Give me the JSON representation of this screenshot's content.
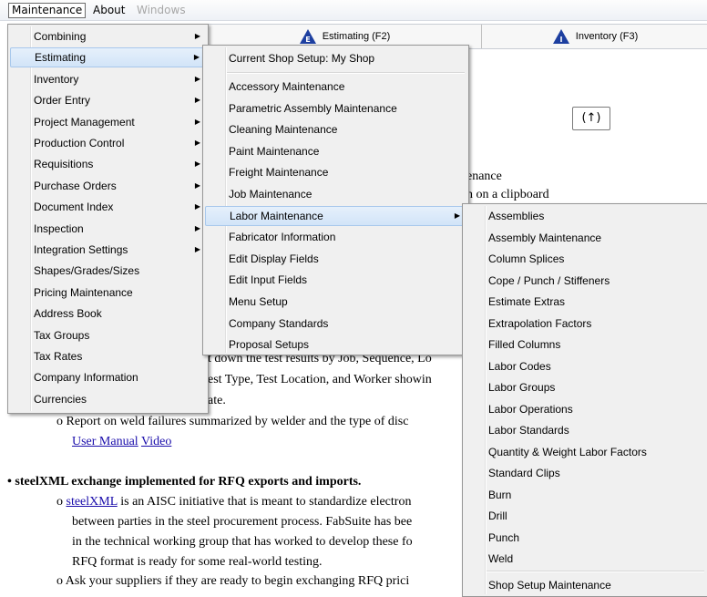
{
  "menubar": {
    "maintenance": "Maintenance",
    "about": "About",
    "windows": "Windows"
  },
  "tabs": {
    "estimating": "Estimating (F2)",
    "inventory": "Inventory (F3)"
  },
  "help_button": "(↑)",
  "document": {
    "fragment_1": "enance",
    "fragment_2": "n on a clipboard",
    "line_a": "t down the test results by Job, Sequence, Lo",
    "line_b": "est Type, Test Location, and Worker showin",
    "line_c": "ate.",
    "bullet_weld": "Report on weld failures summarized by welder and the type of disc",
    "link_manual": "User Manual",
    "link_video": "Video",
    "heading_steelxml": "steelXML exchange implemented for RFQ exports and imports.",
    "link_steelxml": "steelXML",
    "steelxml_line_1": " is an AISC initiative that is meant to standardize electron",
    "steelxml_line_2": "between parties in the steel procurement process. FabSuite has bee",
    "steelxml_line_3": "in the technical working group that has worked to develop these fo",
    "steelxml_line_4": "RFQ format is ready for some real-world testing.",
    "steelxml_line_5": "Ask your suppliers if they are ready to begin exchanging RFQ prici"
  },
  "main_menu": [
    {
      "label": "Combining",
      "submenu": true
    },
    {
      "label": "Estimating",
      "submenu": true,
      "highlighted": true
    },
    {
      "label": "Inventory",
      "submenu": true
    },
    {
      "label": "Order Entry",
      "submenu": true
    },
    {
      "label": "Project Management",
      "submenu": true
    },
    {
      "label": "Production Control",
      "submenu": true
    },
    {
      "label": "Requisitions",
      "submenu": true
    },
    {
      "label": "Purchase Orders",
      "submenu": true
    },
    {
      "label": "Document Index",
      "submenu": true
    },
    {
      "label": "Inspection",
      "submenu": true
    },
    {
      "label": "Integration Settings",
      "submenu": true
    },
    {
      "label": "Shapes/Grades/Sizes",
      "submenu": false
    },
    {
      "label": "Pricing Maintenance",
      "submenu": false
    },
    {
      "label": "Address Book",
      "submenu": false
    },
    {
      "label": "Tax Groups",
      "submenu": false
    },
    {
      "label": "Tax Rates",
      "submenu": false
    },
    {
      "label": "Company Information",
      "submenu": false
    },
    {
      "label": "Currencies",
      "submenu": false
    }
  ],
  "estimating_menu": [
    {
      "label": "Current Shop Setup: My Shop"
    },
    {
      "label": "Accessory Maintenance"
    },
    {
      "label": "Parametric Assembly Maintenance"
    },
    {
      "label": "Cleaning Maintenance"
    },
    {
      "label": "Paint Maintenance"
    },
    {
      "label": "Freight Maintenance"
    },
    {
      "label": "Job Maintenance"
    },
    {
      "label": "Labor Maintenance",
      "submenu": true,
      "highlighted": true
    },
    {
      "label": "Fabricator Information"
    },
    {
      "label": "Edit Display Fields"
    },
    {
      "label": "Edit Input Fields"
    },
    {
      "label": "Menu Setup"
    },
    {
      "label": "Company Standards"
    },
    {
      "label": "Proposal Setups"
    }
  ],
  "labor_menu": [
    {
      "label": "Assemblies"
    },
    {
      "label": "Assembly Maintenance"
    },
    {
      "label": "Column Splices"
    },
    {
      "label": "Cope / Punch / Stiffeners"
    },
    {
      "label": "Estimate Extras"
    },
    {
      "label": "Extrapolation Factors"
    },
    {
      "label": "Filled Columns"
    },
    {
      "label": "Labor Codes"
    },
    {
      "label": "Labor Groups"
    },
    {
      "label": "Labor Operations"
    },
    {
      "label": "Labor Standards"
    },
    {
      "label": "Quantity & Weight Labor Factors"
    },
    {
      "label": "Standard Clips"
    },
    {
      "label": "Burn"
    },
    {
      "label": "Drill"
    },
    {
      "label": "Punch"
    },
    {
      "label": "Weld"
    },
    {
      "label": "Shop Setup Maintenance"
    }
  ],
  "colors": {
    "highlight_bg": "#d2e4f8",
    "highlight_border": "#a8c8ec",
    "link": "#1a0dab",
    "menu_bg": "#f0f0f0"
  }
}
